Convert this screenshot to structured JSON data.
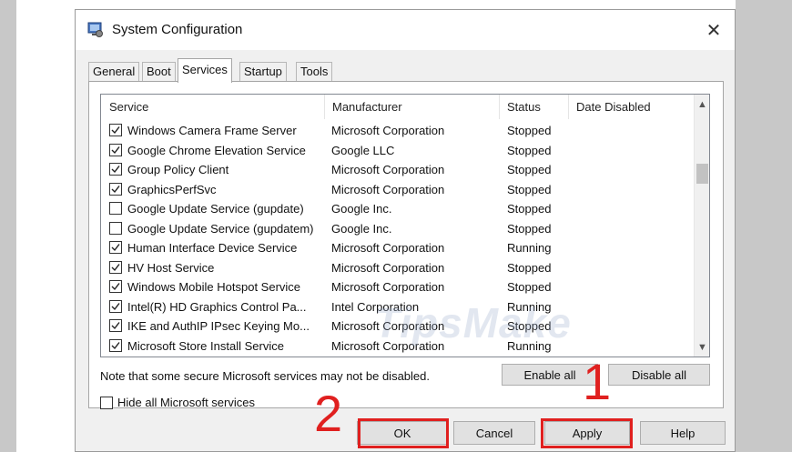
{
  "window": {
    "title": "System Configuration",
    "close_glyph": "✕"
  },
  "tabs": [
    {
      "label": "General"
    },
    {
      "label": "Boot"
    },
    {
      "label": "Services"
    },
    {
      "label": "Startup"
    },
    {
      "label": "Tools"
    }
  ],
  "columns": {
    "service": "Service",
    "manufacturer": "Manufacturer",
    "status": "Status",
    "date_disabled": "Date Disabled"
  },
  "services": [
    {
      "name": "Windows Camera Frame Server",
      "manufacturer": "Microsoft Corporation",
      "status": "Stopped",
      "checked": true
    },
    {
      "name": "Google Chrome Elevation Service",
      "manufacturer": "Google LLC",
      "status": "Stopped",
      "checked": true
    },
    {
      "name": "Group Policy Client",
      "manufacturer": "Microsoft Corporation",
      "status": "Stopped",
      "checked": true
    },
    {
      "name": "GraphicsPerfSvc",
      "manufacturer": "Microsoft Corporation",
      "status": "Stopped",
      "checked": true
    },
    {
      "name": "Google Update Service (gupdate)",
      "manufacturer": "Google Inc.",
      "status": "Stopped",
      "checked": false
    },
    {
      "name": "Google Update Service (gupdatem)",
      "manufacturer": "Google Inc.",
      "status": "Stopped",
      "checked": false
    },
    {
      "name": "Human Interface Device Service",
      "manufacturer": "Microsoft Corporation",
      "status": "Running",
      "checked": true
    },
    {
      "name": "HV Host Service",
      "manufacturer": "Microsoft Corporation",
      "status": "Stopped",
      "checked": true
    },
    {
      "name": "Windows Mobile Hotspot Service",
      "manufacturer": "Microsoft Corporation",
      "status": "Stopped",
      "checked": true
    },
    {
      "name": "Intel(R) HD Graphics Control Pa...",
      "manufacturer": "Intel Corporation",
      "status": "Running",
      "checked": true
    },
    {
      "name": "IKE and AuthIP IPsec Keying Mo...",
      "manufacturer": "Microsoft Corporation",
      "status": "Stopped",
      "checked": true
    },
    {
      "name": "Microsoft Store Install Service",
      "manufacturer": "Microsoft Corporation",
      "status": "Running",
      "checked": true
    }
  ],
  "watermark": "TipsMake",
  "note": "Note that some secure Microsoft services may not be disabled.",
  "enable_all": "Enable all",
  "disable_all": "Disable all",
  "hide_ms": {
    "label": "Hide all Microsoft services",
    "checked": false
  },
  "buttons": {
    "ok": "OK",
    "cancel": "Cancel",
    "apply": "Apply",
    "help": "Help"
  },
  "annotations": {
    "step1": "1",
    "step2": "2"
  },
  "colors": {
    "highlight": "#e0201f"
  }
}
